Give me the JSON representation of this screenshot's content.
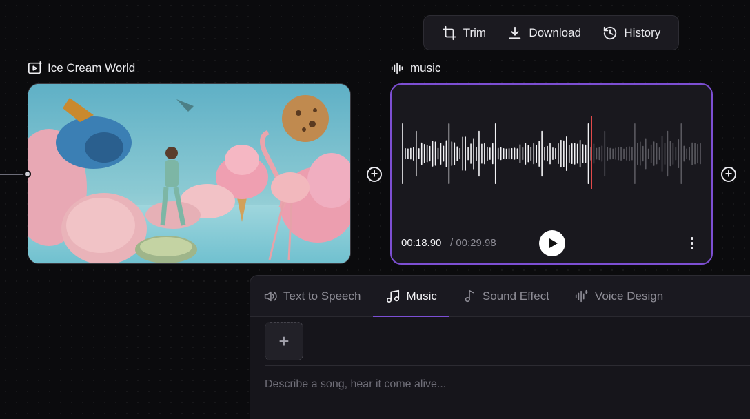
{
  "toolbar": {
    "trim_label": "Trim",
    "download_label": "Download",
    "history_label": "History"
  },
  "video_node": {
    "title": "Ice Cream World"
  },
  "music_node": {
    "title": "music",
    "time_current": "00:18.90",
    "time_total": "/ 00:29.98",
    "playhead_fraction": 0.63,
    "accent_color": "#7d4fd3",
    "playhead_color": "#e24a4a"
  },
  "panel": {
    "tabs": [
      {
        "label": "Text to Speech",
        "icon": "speaker-icon",
        "active": false
      },
      {
        "label": "Music",
        "icon": "music-note-icon",
        "active": true
      },
      {
        "label": "Sound Effect",
        "icon": "note-icon",
        "active": false
      },
      {
        "label": "Voice Design",
        "icon": "voice-design-icon",
        "active": false
      }
    ],
    "prompt_placeholder": "Describe a song, hear it come alive...",
    "prompt_value": ""
  }
}
